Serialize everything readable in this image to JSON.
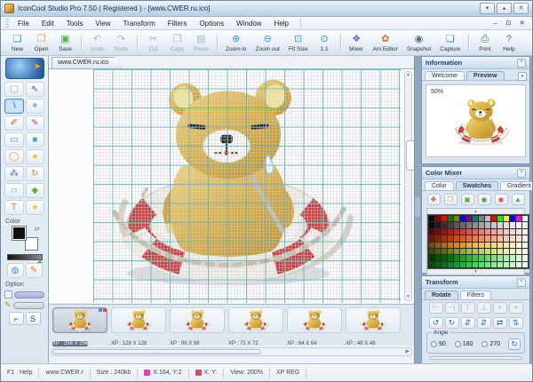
{
  "window": {
    "title": "IconCool Studio Pro 7.50 ( Registered ) - [www.CWER.ru.ico]",
    "controls": [
      {
        "name": "minimize-button",
        "glyph": "▾"
      },
      {
        "name": "maximize-button",
        "glyph": "▴"
      },
      {
        "name": "close-button",
        "glyph": "✕"
      }
    ]
  },
  "menu": {
    "items": [
      "File",
      "Edit",
      "Tools",
      "View",
      "Transform",
      "Filters",
      "Options",
      "Window",
      "Help"
    ],
    "mdi": [
      {
        "name": "mdi-minimize-button",
        "glyph": "–"
      },
      {
        "name": "mdi-restore-button",
        "glyph": "⊡"
      },
      {
        "name": "mdi-close-button",
        "glyph": "✕"
      }
    ]
  },
  "toolbar": {
    "buttons": [
      {
        "name": "new-button",
        "label": "New",
        "glyph": "❑",
        "color": "#3f8fd6",
        "enabled": true
      },
      {
        "name": "open-button",
        "label": "Open",
        "glyph": "❒",
        "color": "#e8a23c",
        "enabled": true
      },
      {
        "name": "save-button",
        "label": "Save",
        "glyph": "▣",
        "color": "#58b043",
        "enabled": true,
        "sep_after": true
      },
      {
        "name": "undo-button",
        "label": "Undo",
        "glyph": "↶",
        "color": "#9aa4ad",
        "enabled": false
      },
      {
        "name": "redo-button",
        "label": "Redo",
        "glyph": "↷",
        "color": "#9aa4ad",
        "enabled": false,
        "sep_after": true
      },
      {
        "name": "cut-button",
        "label": "Cut",
        "glyph": "✂",
        "color": "#9aa4ad",
        "enabled": false
      },
      {
        "name": "copy-button",
        "label": "Copy",
        "glyph": "❐",
        "color": "#9aa4ad",
        "enabled": false
      },
      {
        "name": "paste-button",
        "label": "Paste",
        "glyph": "▤",
        "color": "#9aa4ad",
        "enabled": false,
        "sep_after": true
      },
      {
        "name": "zoom-in-button",
        "label": "Zoom in",
        "glyph": "⊕",
        "color": "#3f8fd6",
        "enabled": true
      },
      {
        "name": "zoom-out-button",
        "label": "Zoom out",
        "glyph": "⊖",
        "color": "#3f8fd6",
        "enabled": true
      },
      {
        "name": "fit-size-button",
        "label": "Fit Size",
        "glyph": "⊡",
        "color": "#3f8fd6",
        "enabled": true
      },
      {
        "name": "one-to-one-button",
        "label": "1:1",
        "glyph": "⊙",
        "color": "#3f8fd6",
        "enabled": true,
        "sep_after": true
      },
      {
        "name": "mixer-button",
        "label": "Mixer",
        "glyph": "❖",
        "color": "#7a5fd0",
        "enabled": true
      },
      {
        "name": "ani-editor-button",
        "label": "Ani Editor",
        "glyph": "✿",
        "color": "#e86a20",
        "enabled": true
      },
      {
        "name": "snapshot-button",
        "label": "Snapshot",
        "glyph": "◉",
        "color": "#5a6a78",
        "enabled": true
      },
      {
        "name": "capture-button",
        "label": "Capture",
        "glyph": "❏",
        "color": "#3f8fd6",
        "enabled": true,
        "sep_after": true
      },
      {
        "name": "print-button",
        "label": "Print",
        "glyph": "⎙",
        "color": "#5a6a78",
        "enabled": true
      },
      {
        "name": "help-button",
        "label": "Help",
        "glyph": "?",
        "color": "#2a7fd4",
        "enabled": true
      }
    ]
  },
  "toolbox": {
    "tools": [
      {
        "name": "select-tool",
        "glyph": "⬚",
        "color": "#4a5a68"
      },
      {
        "name": "move-tool",
        "glyph": "⇖",
        "color": "#4a5a68"
      },
      {
        "name": "line-tool",
        "glyph": "∖",
        "color": "#2f6fc0",
        "active": true
      },
      {
        "name": "magic-wand-tool",
        "glyph": "✶",
        "color": "#8a94a0"
      },
      {
        "name": "eraser-pen-tool",
        "glyph": "✐",
        "color": "#d05040"
      },
      {
        "name": "brush-tool",
        "glyph": "✎",
        "color": "#c04848"
      },
      {
        "name": "rectangle-tool",
        "glyph": "▭",
        "color": "#3f8fd6"
      },
      {
        "name": "filled-rectangle-tool",
        "glyph": "■",
        "color": "#5aa0e0"
      },
      {
        "name": "ellipse-tool",
        "glyph": "◯",
        "color": "#e8a23c"
      },
      {
        "name": "filled-ellipse-tool",
        "glyph": "●",
        "color": "#f0c030"
      },
      {
        "name": "airbrush-tool",
        "glyph": "⁂",
        "color": "#4a78c0"
      },
      {
        "name": "rotate3d-tool",
        "glyph": "↻",
        "color": "#e07828"
      },
      {
        "name": "eraser-tool",
        "glyph": "▱",
        "color": "#9aa4ad"
      },
      {
        "name": "fill-tool",
        "glyph": "◆",
        "color": "#58b043"
      },
      {
        "name": "text-tool",
        "glyph": "T",
        "color": "#e07828"
      },
      {
        "name": "bulb-tool",
        "glyph": "●",
        "color": "#e8c83c"
      }
    ],
    "extra_buttons": [
      {
        "name": "web-export-button",
        "glyph": "◍",
        "color": "#3f8fd6"
      },
      {
        "name": "edit-button",
        "glyph": "✎",
        "color": "#e07828"
      }
    ],
    "color_label": "Color",
    "option_label": "Option",
    "option_buttons": [
      {
        "name": "corner-button",
        "glyph": "⌐"
      },
      {
        "name": "smooth-button",
        "glyph": "S"
      }
    ]
  },
  "canvas": {
    "tab_label": "www.CWER.ru.ico"
  },
  "filmstrip": {
    "items": [
      {
        "label": "XP : 256 X 256",
        "selected": true
      },
      {
        "label": "XP : 128 X 128"
      },
      {
        "label": "XP : 96 X 96"
      },
      {
        "label": "XP : 72 X 72"
      },
      {
        "label": "XP : 64 X 64"
      },
      {
        "label": "XP : 48 X 48"
      }
    ]
  },
  "information": {
    "title": "Information",
    "tabs": [
      {
        "name": "tab-welcome",
        "label": "Welcome"
      },
      {
        "name": "tab-preview",
        "label": "Preview",
        "active": true
      }
    ],
    "zoom_text": "50%"
  },
  "color_mixer": {
    "title": "Color Mixer",
    "tabs": [
      {
        "name": "tab-color",
        "label": "Color"
      },
      {
        "name": "tab-swatches",
        "label": "Swatches",
        "active": true
      },
      {
        "name": "tab-gradient",
        "label": "Gradient"
      }
    ],
    "tool_buttons": [
      {
        "name": "mix-colors-button",
        "glyph": "❖",
        "color": "#c04848"
      },
      {
        "name": "open-palette-button",
        "glyph": "❒",
        "color": "#e8a23c"
      },
      {
        "name": "save-palette-button",
        "glyph": "▣",
        "color": "#58b043"
      },
      {
        "name": "export-palette-button",
        "glyph": "◉",
        "color": "#4a9a4a"
      },
      {
        "name": "delete-palette-button",
        "glyph": "◉",
        "color": "#d05040"
      },
      {
        "name": "import-palette-button",
        "glyph": "▲",
        "color": "#3fae3f"
      }
    ],
    "palette": [
      "#000000",
      "#7f0000",
      "#ff0000",
      "#007f00",
      "#7f7f00",
      "#0000ff",
      "#7f007f",
      "#007f7f",
      "#7f7f7f",
      "#bfbfbf",
      "#ff0000",
      "#00ff00",
      "#ffff00",
      "#0000ff",
      "#ff00ff",
      "#ffffff",
      "#0a0a0a",
      "#1d1d1d",
      "#303030",
      "#434343",
      "#565656",
      "#696969",
      "#7c7c7c",
      "#8f8f8f",
      "#a2a2a2",
      "#b5b5b5",
      "#c8c8c8",
      "#d6d6d6",
      "#e1e1e1",
      "#ebebeb",
      "#f5f5f5",
      "#ffffff",
      "#5e0000",
      "#7a0a0a",
      "#961414",
      "#b21e1e",
      "#c62828",
      "#d63c3c",
      "#e05050",
      "#e86464",
      "#ee7878",
      "#f28c8c",
      "#f5a0a0",
      "#f7b4b4",
      "#f9c8c8",
      "#fbd6d6",
      "#fde4e4",
      "#fff2f2",
      "#6e1c00",
      "#8a2600",
      "#a63000",
      "#c23a00",
      "#d64a10",
      "#e05a20",
      "#e86a30",
      "#ee7a40",
      "#f28a55",
      "#f59a6a",
      "#f7aa80",
      "#f9ba96",
      "#fbcaac",
      "#fcd8c2",
      "#fde6d8",
      "#fff4ee",
      "#7a4a00",
      "#965a00",
      "#b26a00",
      "#c87a00",
      "#d88a10",
      "#e49a20",
      "#ecaa30",
      "#f2ba40",
      "#f5c455",
      "#f7ce6a",
      "#f9d880",
      "#fae096",
      "#fbe8ac",
      "#fcf0c2",
      "#fdf6d8",
      "#fffcee",
      "#3a4a00",
      "#4a5e00",
      "#5a7200",
      "#6a8600",
      "#7a9a10",
      "#8aae20",
      "#9ac230",
      "#aace40",
      "#b8d655",
      "#c6de6a",
      "#d2e680",
      "#dcec96",
      "#e6f2ac",
      "#eef6c2",
      "#f5fad8",
      "#fcfeee",
      "#003a00",
      "#004e00",
      "#006200",
      "#007600",
      "#108a10",
      "#209e20",
      "#30b230",
      "#40c640",
      "#55ce55",
      "#6ad66a",
      "#80de80",
      "#96e696",
      "#aceeac",
      "#c2f4c2",
      "#d8fad8",
      "#eefeee",
      "#00500a",
      "#006414",
      "#00781e",
      "#008c28",
      "#10a032",
      "#20b43c",
      "#30c846",
      "#40dc50",
      "#55e464",
      "#6aea78",
      "#80f08c",
      "#96f4a0",
      "#acf8b4",
      "#c2fac8",
      "#d8fcdc",
      "#eefef0"
    ]
  },
  "transform": {
    "title": "Transform",
    "tabs": [
      {
        "name": "tab-rotate",
        "label": "Rotate",
        "active": true
      },
      {
        "name": "tab-filters",
        "label": "Filters"
      }
    ],
    "align_buttons": [
      {
        "name": "align-left-button",
        "glyph": "⊢"
      },
      {
        "name": "align-right-button",
        "glyph": "⊣"
      },
      {
        "name": "align-top-button",
        "glyph": "⊤"
      },
      {
        "name": "align-bottom-button",
        "glyph": "⊥"
      },
      {
        "name": "center-horizontal-button",
        "glyph": "+"
      },
      {
        "name": "center-vertical-button",
        "glyph": "+"
      }
    ],
    "rotate_buttons": [
      {
        "name": "rotate-ccw-button",
        "glyph": "↺"
      },
      {
        "name": "rotate-cw-button",
        "glyph": "↻"
      },
      {
        "name": "nudge-vertical-button",
        "glyph": "⇵"
      },
      {
        "name": "nudge-vertical2-button",
        "glyph": "⇵"
      },
      {
        "name": "flip-horizontal-button",
        "glyph": "⇄"
      },
      {
        "name": "flip-vertical-button",
        "glyph": "⇅"
      }
    ],
    "angle": {
      "label": "Angle",
      "options": [
        {
          "label": "90"
        },
        {
          "label": "180"
        },
        {
          "label": "270"
        }
      ],
      "apply_glyph": "↻"
    }
  },
  "statusbar": {
    "items": [
      {
        "text": "F1 : Help",
        "icon": ""
      },
      {
        "text": "www.CWER.r",
        "icon": ""
      },
      {
        "text": "Size : 240kb",
        "icon": ""
      },
      {
        "text": "X:164, Y:2",
        "icon": "#e040c0"
      },
      {
        "text": "X: Y:",
        "icon": "#d05060"
      },
      {
        "text": "View: 200%",
        "icon": ""
      },
      {
        "text": "XP REG",
        "icon": ""
      }
    ]
  },
  "colors": {
    "accent": "#2f6fc0",
    "grid_major": "#6ab2b6",
    "ring_red": "#cb3c3e",
    "bear_gold": "#d9a93c"
  }
}
